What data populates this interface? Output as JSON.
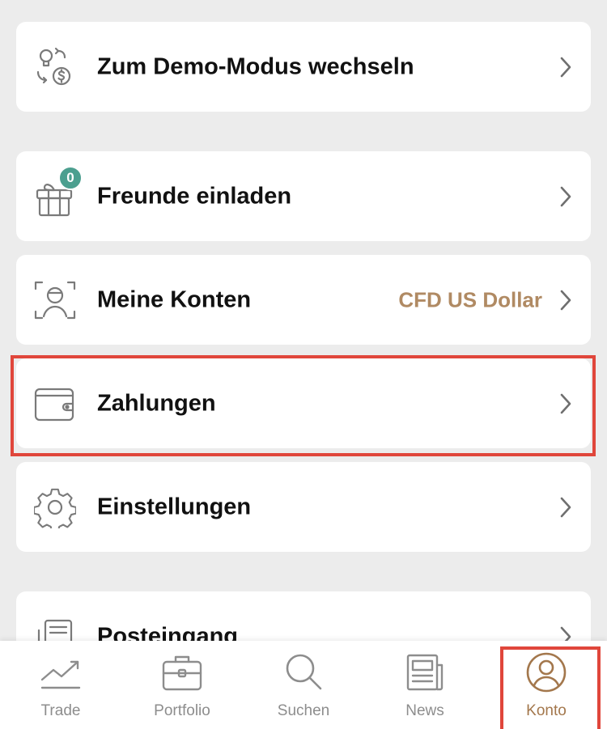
{
  "menu": {
    "demo_mode": {
      "label": "Zum Demo-Modus wechseln",
      "icon": "demo-switch-icon"
    },
    "invite": {
      "label": "Freunde einladen",
      "badge": "0",
      "icon": "gift-icon"
    },
    "accounts": {
      "label": "Meine Konten",
      "value": "CFD US Dollar",
      "icon": "account-scan-icon"
    },
    "payments": {
      "label": "Zahlungen",
      "icon": "wallet-icon"
    },
    "settings": {
      "label": "Einstellungen",
      "icon": "gear-icon"
    },
    "inbox": {
      "label": "Posteingang",
      "icon": "inbox-icon"
    }
  },
  "tabbar": {
    "items": [
      {
        "label": "Trade",
        "icon": "trend-icon",
        "active": false
      },
      {
        "label": "Portfolio",
        "icon": "briefcase-icon",
        "active": false
      },
      {
        "label": "Suchen",
        "icon": "search-icon",
        "active": false
      },
      {
        "label": "News",
        "icon": "newspaper-icon",
        "active": false
      },
      {
        "label": "Konto",
        "icon": "user-icon",
        "active": true
      }
    ]
  },
  "colors": {
    "background": "#ececec",
    "accent": "#a3774c",
    "value_text": "#b08a63",
    "badge": "#4c9f8f",
    "highlight": "#e0463b"
  }
}
